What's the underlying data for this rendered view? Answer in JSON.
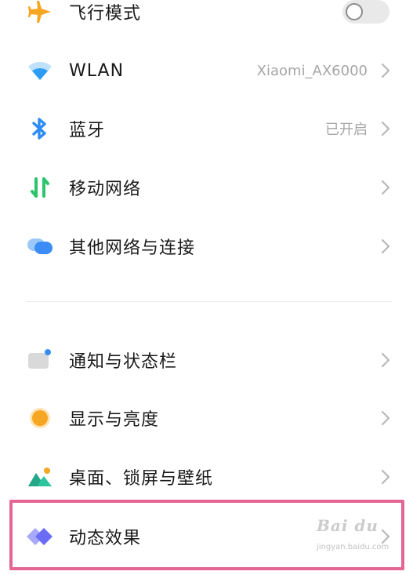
{
  "settings": {
    "group1": [
      {
        "label": "飞行模式",
        "icon": "airplane-icon",
        "control": "toggle",
        "toggle_on": false
      },
      {
        "label": "WLAN",
        "icon": "wifi-icon",
        "value": "Xiaomi_AX6000"
      },
      {
        "label": "蓝牙",
        "icon": "bluetooth-icon",
        "value": "已开启"
      },
      {
        "label": "移动网络",
        "icon": "mobile-data-icon"
      },
      {
        "label": "其他网络与连接",
        "icon": "other-connections-icon"
      }
    ],
    "group2": [
      {
        "label": "通知与状态栏",
        "icon": "notification-icon"
      },
      {
        "label": "显示与亮度",
        "icon": "display-brightness-icon"
      },
      {
        "label": "桌面、锁屏与壁纸",
        "icon": "wallpaper-icon"
      },
      {
        "label": "动态效果",
        "icon": "motion-effects-icon"
      }
    ]
  },
  "colors": {
    "airplane": "#f5a623",
    "wifi": "#2d9cf5",
    "bluetooth": "#2d8cf5",
    "mobile_data": "#2ec46c",
    "other_connections": "#3b8df5",
    "notification": "#d9d9d9",
    "notification_dot": "#3b8df5",
    "display": "#f5a623",
    "wallpaper": "#2ec4a0",
    "motion": "#6b6cf5",
    "highlight_border": "#e46593"
  },
  "watermark": {
    "text": "Bai du",
    "subtext": "jingyan.baidu.com"
  }
}
